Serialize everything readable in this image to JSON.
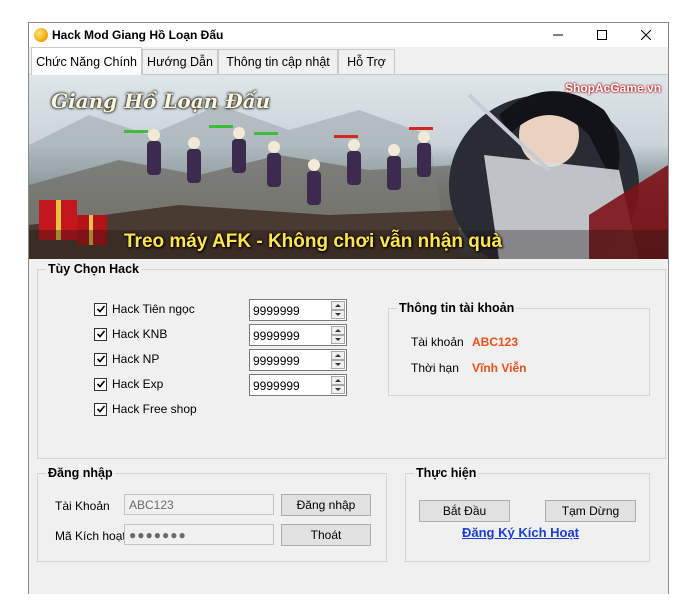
{
  "window": {
    "title": "Hack Mod Giang Hồ Loạn Đấu"
  },
  "tabs": [
    {
      "label": "Chức Năng Chính"
    },
    {
      "label": "Hướng Dẫn"
    },
    {
      "label": "Thông tin cập nhật"
    },
    {
      "label": "Hỗ Trợ"
    }
  ],
  "banner": {
    "logo": "Giang Hồ Loạn Đấu",
    "watermark": "ShopAcGame.vn",
    "slogan": "Treo máy AFK - Không chơi vẫn nhận quà"
  },
  "hack_options": {
    "title": "Tùy Chọn Hack",
    "items": [
      {
        "label": "Hack Tiên ngọc",
        "checked": true,
        "value": "9999999"
      },
      {
        "label": "Hack KNB",
        "checked": true,
        "value": "9999999"
      },
      {
        "label": "Hack NP",
        "checked": true,
        "value": "9999999"
      },
      {
        "label": "Hack Exp",
        "checked": true,
        "value": "9999999"
      },
      {
        "label": "Hack Free shop",
        "checked": true
      }
    ]
  },
  "account_info": {
    "title": "Thông tin tài khoản",
    "account_label": "Tài khoản",
    "account_value": "ABC123",
    "term_label": "Thời hạn",
    "term_value": "Vĩnh Viễn"
  },
  "login": {
    "title": "Đăng nhập",
    "account_label": "Tài Khoản",
    "account_value": "ABC123",
    "code_label": "Mã Kích hoạt",
    "code_value": "●●●●●●●",
    "login_button": "Đăng nhập",
    "exit_button": "Thoát"
  },
  "execute": {
    "title": "Thực hiện",
    "start_button": "Bắt Đầu",
    "pause_button": "Tạm Dừng",
    "register_link": "Đăng Ký Kích Hoạt"
  },
  "colors": {
    "accent_orange": "#e8511a",
    "link_blue": "#1a3ed8",
    "window_bg": "#f0f0f0"
  }
}
